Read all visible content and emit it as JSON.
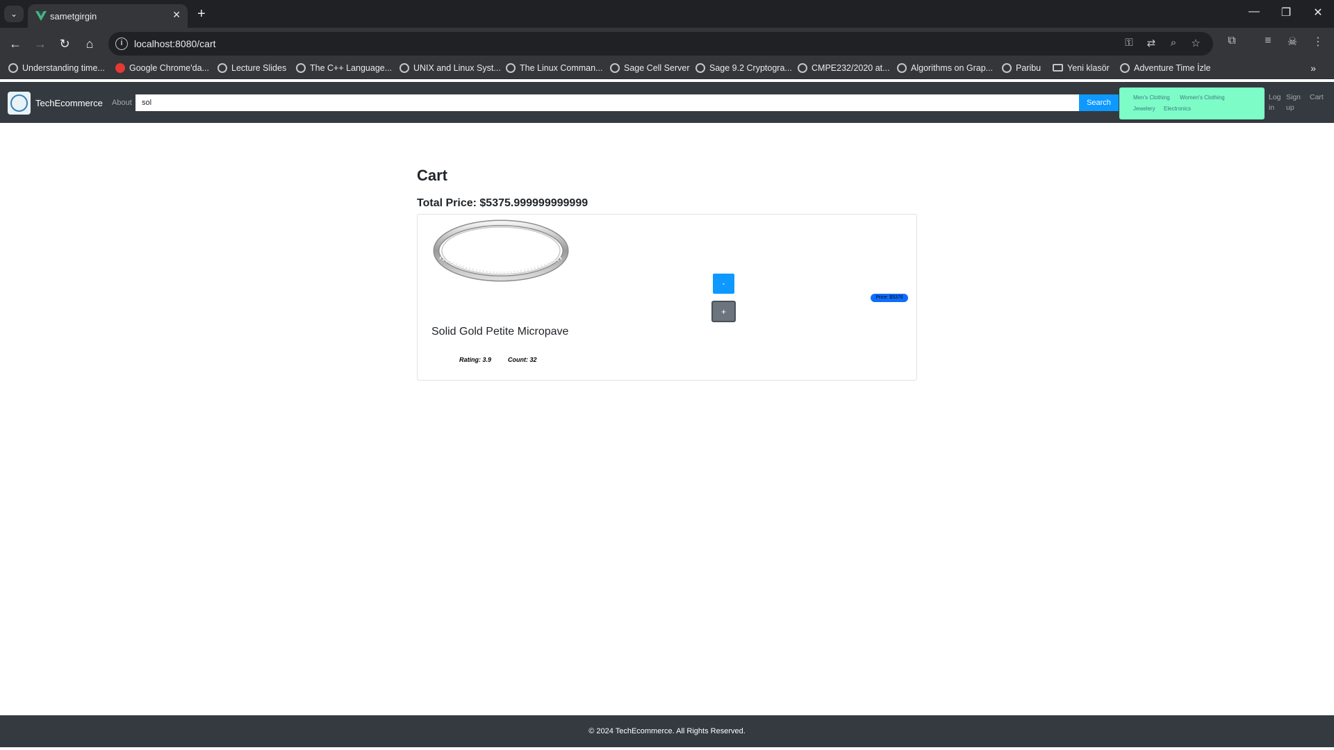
{
  "browser": {
    "tab_title": "sametgirgin",
    "url": "localhost:8080/cart",
    "bookmarks": [
      {
        "label": "Understanding time...",
        "icon": "globe-icon"
      },
      {
        "label": "Google Chrome'da...",
        "icon": "chrome-red-icon"
      },
      {
        "label": "Lecture Slides",
        "icon": "globe-icon"
      },
      {
        "label": "The C++ Language...",
        "icon": "globe-icon"
      },
      {
        "label": "UNIX and Linux Syst...",
        "icon": "globe-icon"
      },
      {
        "label": "The Linux Comman...",
        "icon": "globe-icon"
      },
      {
        "label": "Sage Cell Server",
        "icon": "globe-icon"
      },
      {
        "label": "Sage 9.2 Cryptogra...",
        "icon": "globe-icon"
      },
      {
        "label": "CMPE232/2020 at...",
        "icon": "globe-icon"
      },
      {
        "label": "Algorithms on Grap...",
        "icon": "globe-icon"
      },
      {
        "label": "Paribu",
        "icon": "globe-icon"
      },
      {
        "label": "Yeni klasör",
        "icon": "folder-icon"
      },
      {
        "label": "Adventure Time İzle",
        "icon": "globe-icon"
      }
    ]
  },
  "site": {
    "brand": "TechEcommerce",
    "about": "About",
    "search_value": "sol",
    "search_button": "Search",
    "categories": [
      "Men's Clothing",
      "Women's Clothing",
      "Jewelery",
      "Electronics"
    ],
    "login": "Log in",
    "signup": "Sign up",
    "cart": "Cart",
    "accent_color": "#0d99ff",
    "category_bg": "#7dfcc8"
  },
  "cart": {
    "title": "Cart",
    "total": "Total Price: $5375.999999999999",
    "items": [
      {
        "name": "Solid Gold Petite Micropave",
        "rating": "Rating: 3.9",
        "count": "Count: 32",
        "minus_label": "-",
        "plus_label": "+",
        "price_badge": "Price: $5376"
      }
    ]
  },
  "footer": {
    "text": "© 2024 TechEcommerce. All Rights Reserved."
  }
}
